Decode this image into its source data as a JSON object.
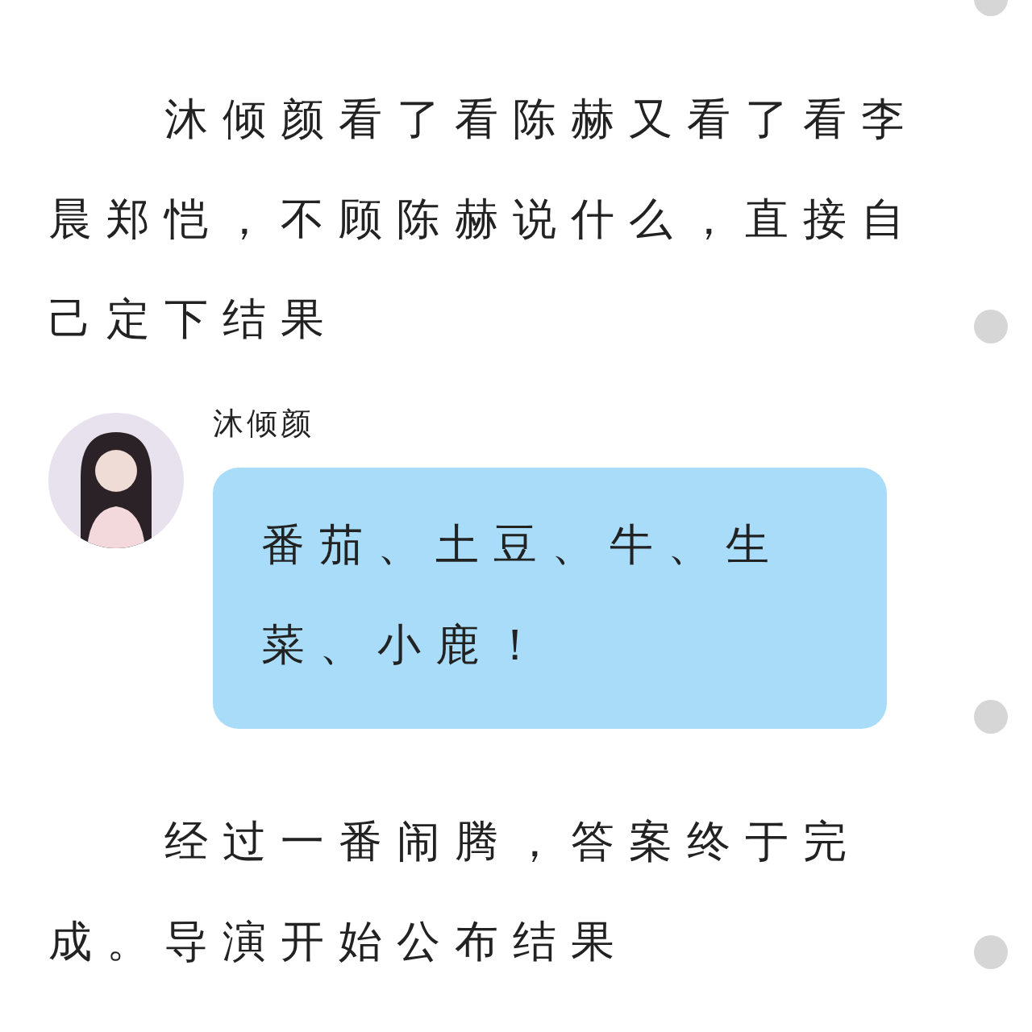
{
  "paragraphs_top": [
    "沐倾颜看了看陈赫又看了看李晨郑恺，不顾陈赫说什么，直接自己定下结果"
  ],
  "message": {
    "sender": "沐倾颜",
    "text": "番茄、土豆、牛、生菜、小鹿！"
  },
  "paragraphs_bottom": [
    "经过一番闹腾，答案终于完成。导演开始公布结果"
  ]
}
